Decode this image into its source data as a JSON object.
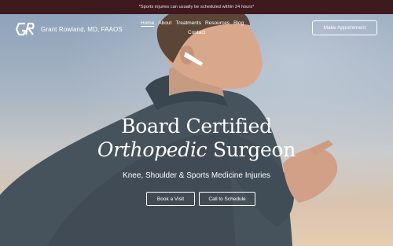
{
  "announcement": "*Sports injuries can usually be scheduled within 24 hours*",
  "brand": {
    "name": "Grant Rowland, MD, FAAOS",
    "logo_icon": "gr-monogram-icon"
  },
  "nav": {
    "items": [
      "Home",
      "About",
      "Treatments",
      "Resources",
      "Blog"
    ],
    "contact": "Contact",
    "active": "Home"
  },
  "cta": {
    "label": "Make Appointment"
  },
  "hero": {
    "line1": "Board Certified",
    "line2_italic": "Orthopedic",
    "line2_rest": " Surgeon",
    "subtitle": "Knee, Shoulder & Sports Medicine Injuries",
    "buttons": {
      "book": "Book a Visit",
      "call": "Call to Schedule"
    }
  },
  "colors": {
    "announcement_bg": "#3e1a1f",
    "text": "#ffffff",
    "sky": "#8ea2ba",
    "jacket": "#4a5660"
  }
}
